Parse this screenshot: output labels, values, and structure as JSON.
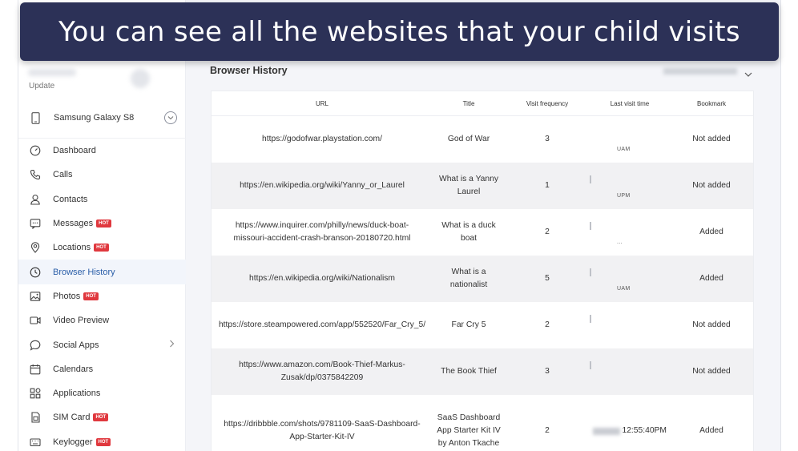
{
  "banner": {
    "text": "You can see all the websites that your child visits"
  },
  "sidebar": {
    "update_label": "Update",
    "device_name": "Samsung Galaxy S8",
    "hot_badge": "HOT",
    "items": [
      {
        "label": "Dashboard",
        "icon": "gauge-icon",
        "hot": false
      },
      {
        "label": "Calls",
        "icon": "phone-icon",
        "hot": false
      },
      {
        "label": "Contacts",
        "icon": "person-icon",
        "hot": false
      },
      {
        "label": "Messages",
        "icon": "message-icon",
        "hot": true
      },
      {
        "label": "Locations",
        "icon": "location-pin-icon",
        "hot": true
      },
      {
        "label": "Browser History",
        "icon": "clock-icon",
        "hot": false,
        "active": true
      },
      {
        "label": "Photos",
        "icon": "image-icon",
        "hot": true
      },
      {
        "label": "Video Preview",
        "icon": "video-icon",
        "hot": false
      },
      {
        "label": "Social Apps",
        "icon": "chat-bubble-icon",
        "hot": false,
        "has_arrow": true
      },
      {
        "label": "Calendars",
        "icon": "calendar-icon",
        "hot": false
      },
      {
        "label": "Applications",
        "icon": "apps-grid-icon",
        "hot": false
      },
      {
        "label": "SIM Card",
        "icon": "sim-card-icon",
        "hot": true
      },
      {
        "label": "Keylogger",
        "icon": "keyboard-icon",
        "hot": true
      }
    ]
  },
  "main": {
    "title": "Browser History",
    "table": {
      "headers": [
        "URL",
        "Title",
        "Visit frequency",
        "Last visit time",
        "Bookmark"
      ],
      "rows": [
        {
          "url": "https://godofwar.playstation.com/",
          "title": "God of War",
          "freq": "3",
          "time_tail": "UAM",
          "bookmark": "Not added"
        },
        {
          "url": "https://en.wikipedia.org/wiki/Yanny_or_Laurel",
          "title": "What is a Yanny Laurel",
          "freq": "1",
          "time_tail": "UPM",
          "bookmark": "Not added"
        },
        {
          "url": "https://www.inquirer.com/philly/news/duck-boat-missouri-accident-crash-branson-20180720.html",
          "title": "What is a duck boat",
          "freq": "2",
          "time_tail": "...",
          "bookmark": "Added"
        },
        {
          "url": "https://en.wikipedia.org/wiki/Nationalism",
          "title": "What is a nationalist",
          "freq": "5",
          "time_tail": "UAM",
          "bookmark": "Added"
        },
        {
          "url": "https://store.steampowered.com/app/552520/Far_Cry_5/",
          "title": "Far Cry 5",
          "freq": "2",
          "time_tail": "",
          "bookmark": "Not added"
        },
        {
          "url": "https://www.amazon.com/Book-Thief-Markus-Zusak/dp/0375842209",
          "title": "The Book Thief",
          "freq": "3",
          "time_tail": "",
          "bookmark": "Not added"
        },
        {
          "url": "https://dribbble.com/shots/9781109-SaaS-Dashboard-App-Starter-Kit-IV",
          "title": "SaaS Dashboard App Starter Kit IV by Anton Tkache",
          "freq": "2",
          "time_tail": "12:55:40PM",
          "bookmark": "Added"
        }
      ]
    }
  }
}
